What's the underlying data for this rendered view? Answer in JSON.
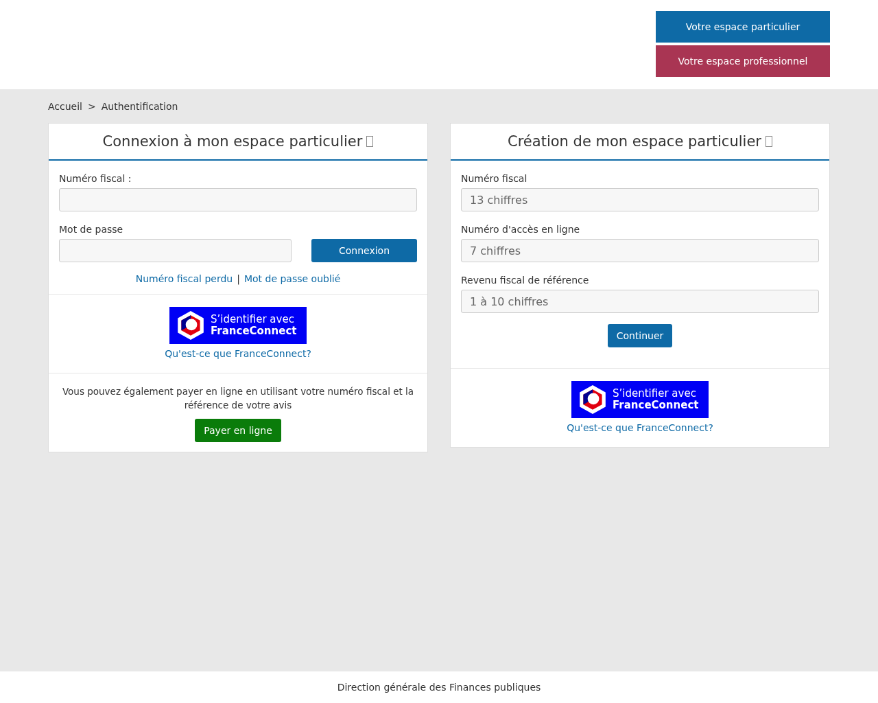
{
  "header": {
    "buttons": [
      {
        "label": "Votre espace particulier",
        "kind": "primary"
      },
      {
        "label": "Votre espace professionnel",
        "kind": "pro"
      }
    ]
  },
  "breadcrumb": [
    "Accueil",
    "Authentification"
  ],
  "breadcrumb_separator": ">",
  "link_separator": "|",
  "login_card": {
    "title": "Connexion à mon espace particulier",
    "fiscal_label": "Numéro fiscal :",
    "password_label": "Mot de passe",
    "submit": "Connexion",
    "links": [
      "Numéro fiscal perdu",
      "Mot de passe oublié"
    ],
    "franceconnect": {
      "line1": "S’identifier avec",
      "line2": "FranceConnect",
      "help": "Qu'est-ce que FranceConnect?"
    },
    "pay_text": "Vous pouvez également payer en ligne en utilisant votre numéro fiscal et la référence de votre avis",
    "pay_button": "Payer en ligne"
  },
  "create_card": {
    "title": "Création de mon espace particulier",
    "fields": [
      {
        "label": "Numéro fiscal",
        "placeholder": "13 chiffres"
      },
      {
        "label": "Numéro d'accès en ligne",
        "placeholder": "7 chiffres"
      },
      {
        "label": "Revenu fiscal de référence",
        "placeholder": "1 à 10 chiffres"
      }
    ],
    "submit": "Continuer",
    "franceconnect": {
      "line1": "S’identifier avec",
      "line2": "FranceConnect",
      "help": "Qu'est-ce que FranceConnect?"
    }
  },
  "footer": "Direction générale des Finances publiques"
}
